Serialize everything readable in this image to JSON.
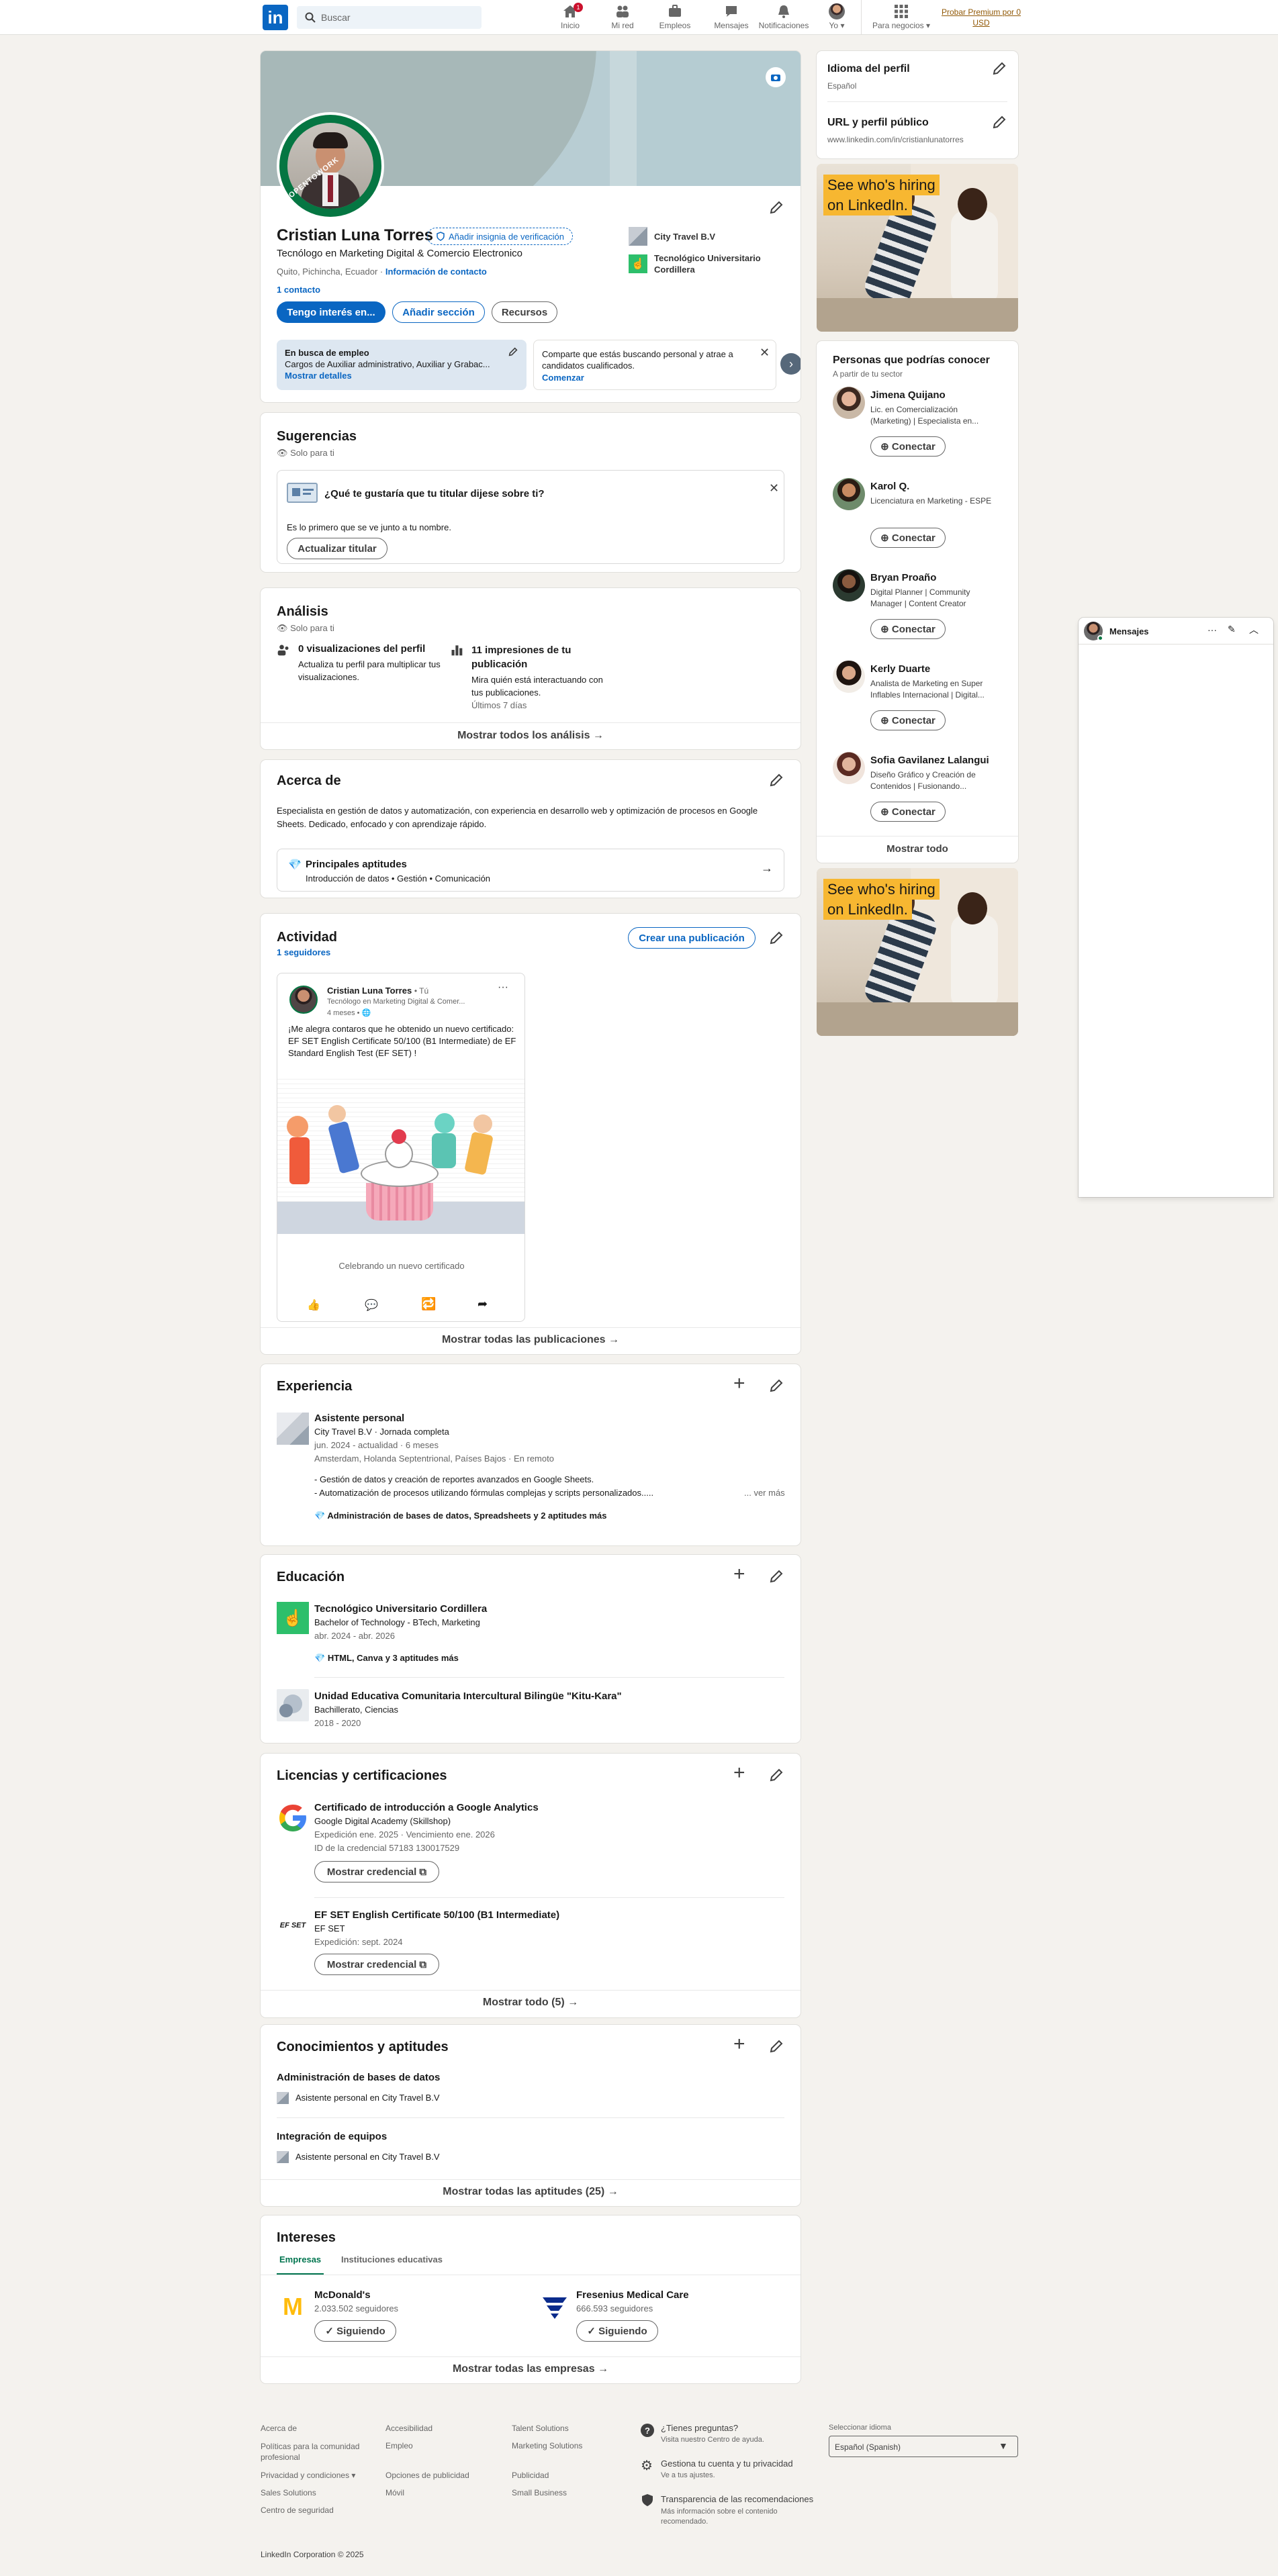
{
  "nav": {
    "search_placeholder": "Buscar",
    "items": [
      {
        "label": "Inicio",
        "badge": "1"
      },
      {
        "label": "Mi red"
      },
      {
        "label": "Empleos"
      },
      {
        "label": "Mensajes"
      },
      {
        "label": "Notificaciones"
      },
      {
        "label": "Yo"
      }
    ],
    "business": "Para negocios",
    "premium_line1": "Probar Premium por 0",
    "premium_line2": "USD"
  },
  "profile": {
    "name": "Cristian Luna Torres",
    "verify": "Añadir insignia de verificación",
    "headline": "Tecnólogo en Marketing Digital & Comercio Electronico",
    "location": "Quito, Pichincha, Ecuador",
    "contact_info": "Información de contacto",
    "contacts": "1 contacto",
    "open_badge": "#OPENTOWORK",
    "companies": [
      "City Travel B.V",
      "Tecnológico Universitario Cordillera"
    ],
    "btn_interest": "Tengo interés en...",
    "btn_add": "Añadir sección",
    "btn_resources": "Recursos",
    "open_card": {
      "title": "En busca de empleo",
      "text": "Cargos de Auxiliar administrativo, Auxiliar y Grabac...",
      "link": "Mostrar detalles"
    },
    "share_card": {
      "text": "Comparte que estás buscando personal y atrae a candidatos cualificados.",
      "link": "Comenzar"
    }
  },
  "suggestions": {
    "title": "Sugerencias",
    "private": "Solo para ti",
    "question": "¿Qué te gustaría que tu titular dijese sobre ti?",
    "text": "Es lo primero que se ve junto a tu nombre.",
    "button": "Actualizar titular"
  },
  "analytics": {
    "title": "Análisis",
    "private": "Solo para ti",
    "views_title": "0 visualizaciones del perfil",
    "views_text": "Actualiza tu perfil para multiplicar tus visualizaciones.",
    "imp_title": "11 impresiones de tu publicación",
    "imp_text": "Mira quién está interactuando con tus publicaciones.",
    "imp_period": "Últimos 7 días",
    "show_all": "Mostrar todos los análisis →"
  },
  "about": {
    "title": "Acerca de",
    "text": "Especialista en gestión de datos y automatización, con experiencia en desarrollo web y optimización de procesos en Google Sheets. Dedicado, enfocado y con aprendizaje rápido.",
    "skills_title": "Principales aptitudes",
    "skills": "Introducción de datos • Gestión • Comunicación"
  },
  "activity": {
    "title": "Actividad",
    "followers": "1 seguidores",
    "create": "Crear una publicación",
    "post_author": "Cristian Luna Torres",
    "post_you": "• Tú",
    "post_headline": "Tecnólogo en Marketing Digital & Comer...",
    "post_time": "4 meses •",
    "post_text": "¡Me alegra contaros que he obtenido un nuevo certificado: EF SET English Certificate 50/100 (B1 Intermediate) de EF Standard English Test (EF SET) !",
    "post_caption": "Celebrando un nuevo certificado",
    "show_all": "Mostrar todas las publicaciones →"
  },
  "experience": {
    "title": "Experiencia",
    "role": "Asistente personal",
    "company": "City Travel B.V · Jornada completa",
    "dates": "jun. 2024 - actualidad · 6 meses",
    "place": "Amsterdam, Holanda Septentrional, Países Bajos · En remoto",
    "bullet1": "- Gestión de datos y creación de reportes avanzados en Google Sheets.",
    "bullet2": "- Automatización de procesos utilizando fórmulas complejas y scripts personalizados.....",
    "more": "... ver más",
    "skills": "Administración de bases de datos, Spreadsheets y 2 aptitudes más"
  },
  "education": {
    "title": "Educación",
    "items": [
      {
        "school": "Tecnológico Universitario Cordillera",
        "degree": "Bachelor of Technology - BTech, Marketing",
        "dates": "abr. 2024 - abr. 2026",
        "skills": "HTML, Canva y 3 aptitudes más"
      },
      {
        "school": "Unidad Educativa Comunitaria Intercultural Bilingüe \"Kitu-Kara\"",
        "degree": "Bachillerato, Ciencias",
        "dates": "2018 - 2020"
      }
    ]
  },
  "licenses": {
    "title": "Licencias y certificaciones",
    "items": [
      {
        "name": "Certificado de introducción a Google Analytics",
        "issuer": "Google Digital Academy (Skillshop)",
        "dates": "Expedición ene. 2025 · Vencimiento ene. 2026",
        "cred": "ID de la credencial 57183 130017529",
        "button": "Mostrar credencial"
      },
      {
        "name": "EF SET English Certificate 50/100 (B1 Intermediate)",
        "issuer": "EF SET",
        "dates": "Expedición: sept. 2024",
        "button": "Mostrar credencial",
        "logo": "EF SET"
      }
    ],
    "show_all": "Mostrar todo (5) →"
  },
  "skills": {
    "title": "Conocimientos y aptitudes",
    "items": [
      {
        "name": "Administración de bases de datos",
        "sub": "Asistente personal en City Travel B.V"
      },
      {
        "name": "Integración de equipos",
        "sub": "Asistente personal en City Travel B.V"
      }
    ],
    "show_all": "Mostrar todas las aptitudes (25) →"
  },
  "interests": {
    "title": "Intereses",
    "tabs": [
      "Empresas",
      "Instituciones educativas"
    ],
    "items": [
      {
        "name": "McDonald's",
        "followers": "2.033.502 seguidores",
        "button": "✓ Siguiendo"
      },
      {
        "name": "Fresenius Medical Care",
        "followers": "666.593 seguidores",
        "button": "✓ Siguiendo"
      }
    ],
    "show_all": "Mostrar todas las empresas →"
  },
  "sidebar": {
    "lang_title": "Idioma del perfil",
    "lang_value": "Español",
    "url_title": "URL y perfil público",
    "url_value": "www.linkedin.com/in/cristianlunatorres",
    "ad_line1": "See who's hiring",
    "ad_line2": "on LinkedIn.",
    "people_title": "Personas que podrías conocer",
    "people_sub": "A partir de tu sector",
    "connect": "Conectar",
    "people": [
      {
        "name": "Jimena Quijano",
        "desc": "Lic. en Comercialización (Marketing) | Especialista en..."
      },
      {
        "name": "Karol Q.",
        "desc": "Licenciatura en Marketing - ESPE"
      },
      {
        "name": "Bryan Proaño",
        "desc": "Digital Planner | Community Manager | Content Creator"
      },
      {
        "name": "Kerly Duarte",
        "desc": "Analista de Marketing en Super Inflables Internacional | Digital..."
      },
      {
        "name": "Sofia Gavilanez Lalangui",
        "desc": "Diseño Gráfico y Creación de Contenidos | Fusionando..."
      }
    ],
    "show_all": "Mostrar todo"
  },
  "messaging": {
    "title": "Mensajes"
  },
  "footer": {
    "col1": [
      "Acerca de",
      "Políticas para la comunidad profesional",
      "Privacidad y condiciones ▾",
      "Sales Solutions",
      "Centro de seguridad"
    ],
    "col2": [
      "Accesibilidad",
      "Empleo",
      "Opciones de publicidad",
      "Móvil"
    ],
    "col3": [
      "Talent Solutions",
      "Marketing Solutions",
      "Publicidad",
      "Small Business"
    ],
    "help_title": "¿Tienes preguntas?",
    "help_sub": "Visita nuestro Centro de ayuda.",
    "manage_title": "Gestiona tu cuenta y tu privacidad",
    "manage_sub": "Ve a tus ajustes.",
    "trans_title": "Transparencia de las recomendaciones",
    "trans_sub": "Más información sobre el contenido recomendado.",
    "lang_label": "Seleccionar idioma",
    "lang_value": "Español (Spanish)",
    "copyright": "LinkedIn Corporation © 2025"
  },
  "colors": {
    "brand": "#0a66c2",
    "open_to_work": "#057642",
    "bg": "#f4f2ee"
  }
}
